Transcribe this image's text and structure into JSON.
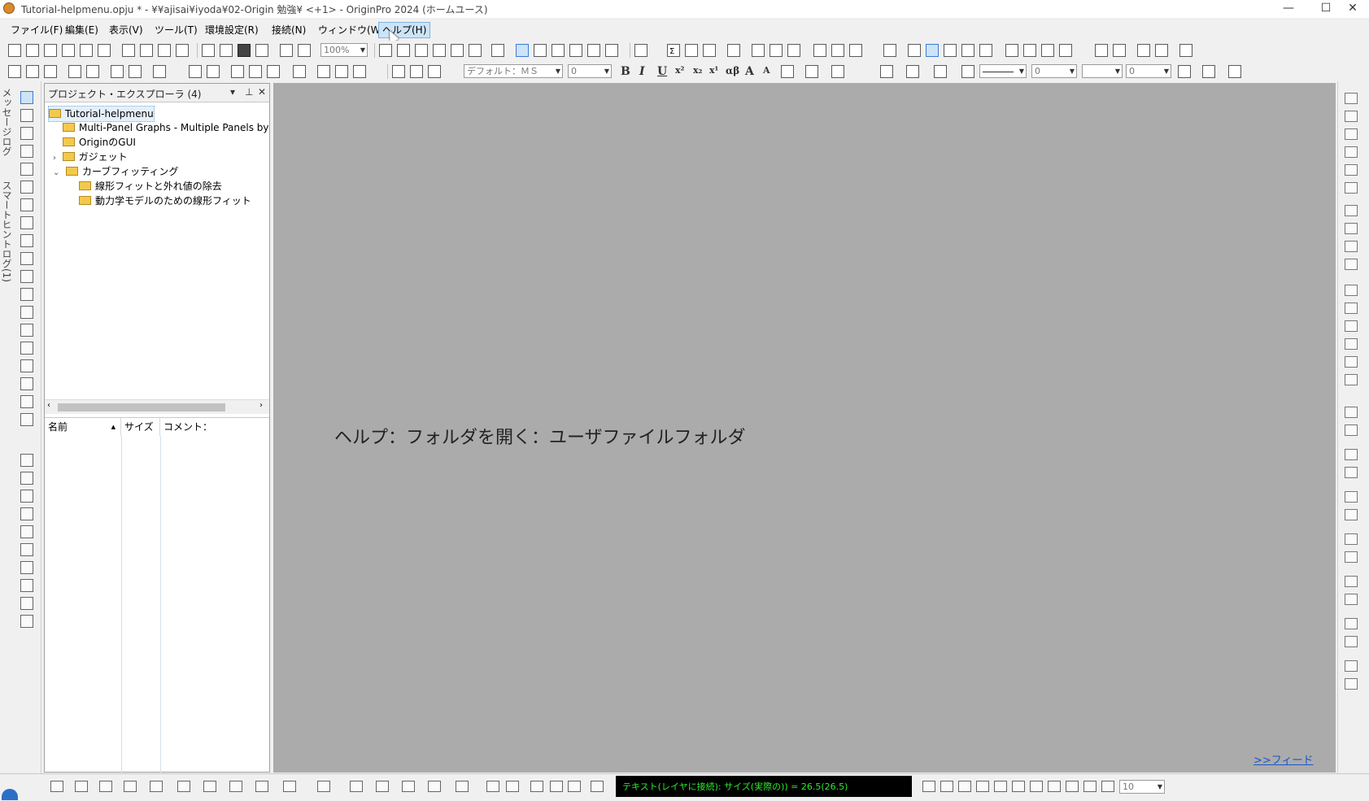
{
  "window": {
    "title": "Tutorial-helpmenu.opju * - ¥¥ajisai¥iyoda¥02-Origin 勉強¥ <+1> - OriginPro 2024 (ホームユース)",
    "minimize_glyph": "—",
    "maximize_glyph": "☐",
    "close_glyph": "✕"
  },
  "menu": {
    "items": [
      "ファイル(F)",
      "編集(E)",
      "表示(V)",
      "ツール(T)",
      "環境設定(R)",
      "接続(N)",
      "ウィンドウ(W)",
      "ヘルプ(H)"
    ],
    "active_index": 7
  },
  "toolbar": {
    "zoom_value": "100%",
    "font_name": "デフォルト：ＭＳ",
    "font_size": "0",
    "format_buttons": [
      "B",
      "I",
      "U",
      "x²",
      "x₂",
      "x¹",
      "αβ",
      "A",
      "A"
    ],
    "line_value": "0",
    "fill_value": "0",
    "greek_label": "αβ",
    "sigma_label": "Σ"
  },
  "left_strip": {
    "labels": [
      "メッセージログ",
      "スマートヒントログ(1)"
    ]
  },
  "explorer": {
    "title": "プロジェクト・エクスプローラ (4)",
    "tree": [
      {
        "label": "Tutorial-helpmenu",
        "level": 0,
        "selected": true
      },
      {
        "label": "Multi-Panel Graphs - Multiple Panels by Col",
        "level": 1
      },
      {
        "label": "OriginのGUI",
        "level": 1
      },
      {
        "label": "ガジェット",
        "level": 1,
        "twisty": "›"
      },
      {
        "label": "カーブフィッティング",
        "level": 1,
        "twisty": "⌄"
      },
      {
        "label": "線形フィットと外れ値の除去",
        "level": 2
      },
      {
        "label": "動力学モデルのための線形フィット",
        "level": 2
      }
    ],
    "columns": [
      "名前",
      "サイズ",
      "コメント："
    ],
    "sort_glyph": "▲"
  },
  "workspace": {
    "tip_text": "ヘルプ：フォルダを開く：ユーザファイルフォルダ",
    "feed_link": ">>フィード"
  },
  "status": {
    "text": "テキスト(レイヤに接続): サイズ(実際の)) = 26.5(26.5)",
    "zoom_value": "10"
  }
}
